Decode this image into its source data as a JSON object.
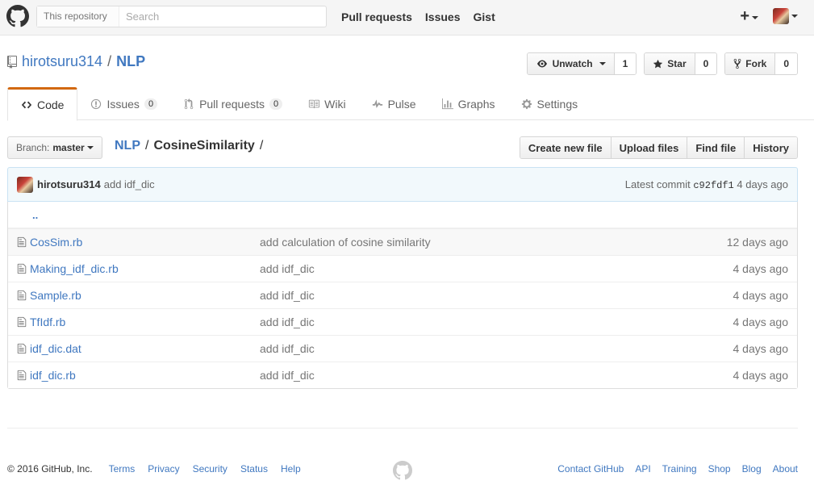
{
  "header": {
    "scope_label": "This repository",
    "search_placeholder": "Search",
    "nav": [
      "Pull requests",
      "Issues",
      "Gist"
    ],
    "plus": "+"
  },
  "repo": {
    "owner": "hirotsuru314",
    "separator": "/",
    "name": "NLP"
  },
  "actions": {
    "watch_label": "Unwatch",
    "watch_count": "1",
    "star_label": "Star",
    "star_count": "0",
    "fork_label": "Fork",
    "fork_count": "0"
  },
  "tabs": [
    {
      "label": "Code",
      "icon": "code-icon"
    },
    {
      "label": "Issues",
      "counter": "0",
      "icon": "issue-icon"
    },
    {
      "label": "Pull requests",
      "counter": "0",
      "icon": "pull-request-icon"
    },
    {
      "label": "Wiki",
      "icon": "book-icon"
    },
    {
      "label": "Pulse",
      "icon": "pulse-icon"
    },
    {
      "label": "Graphs",
      "icon": "graph-icon"
    },
    {
      "label": "Settings",
      "icon": "gear-icon"
    }
  ],
  "branch": {
    "label": "Branch:",
    "value": "master"
  },
  "breadcrumb": {
    "root": "NLP",
    "sep": "/",
    "dir": "CosineSimilarity",
    "trail": "/"
  },
  "file_actions": [
    "Create new file",
    "Upload files",
    "Find file",
    "History"
  ],
  "commit": {
    "author": "hirotsuru314",
    "message": "add idf_dic",
    "latest_label": "Latest commit",
    "sha": "c92fdf1",
    "age": "4 days ago"
  },
  "up_dir": "..",
  "files": [
    {
      "name": "CosSim.rb",
      "message": "add calculation of cosine similarity",
      "age": "12 days ago"
    },
    {
      "name": "Making_idf_dic.rb",
      "message": "add idf_dic",
      "age": "4 days ago"
    },
    {
      "name": "Sample.rb",
      "message": "add idf_dic",
      "age": "4 days ago"
    },
    {
      "name": "TfIdf.rb",
      "message": "add idf_dic",
      "age": "4 days ago"
    },
    {
      "name": "idf_dic.dat",
      "message": "add idf_dic",
      "age": "4 days ago"
    },
    {
      "name": "idf_dic.rb",
      "message": "add idf_dic",
      "age": "4 days ago"
    }
  ],
  "footer": {
    "copyright": "© 2016 GitHub, Inc.",
    "left_links": [
      "Terms",
      "Privacy",
      "Security",
      "Status",
      "Help"
    ],
    "right_links": [
      "Contact GitHub",
      "API",
      "Training",
      "Shop",
      "Blog",
      "About"
    ]
  },
  "colors": {
    "accent": "#4078c0",
    "tab_highlight": "#d26911",
    "commit_bg": "#f2f9fc"
  }
}
